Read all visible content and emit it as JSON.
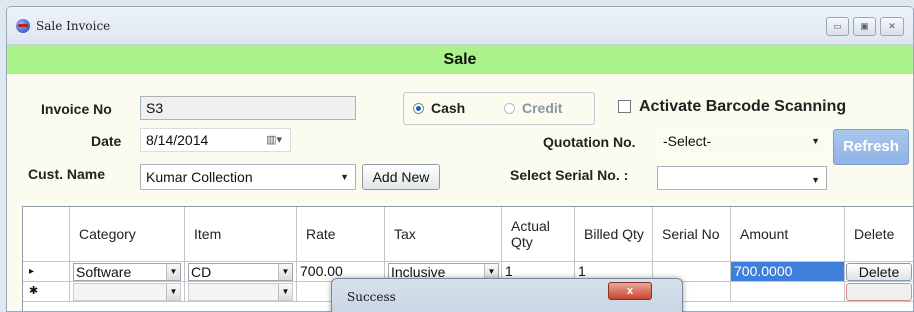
{
  "window": {
    "title": "Sale Invoice",
    "controls": {
      "minimize": "▭",
      "maximize": "▣",
      "close": "✕"
    }
  },
  "banner": {
    "title": "Sale"
  },
  "form": {
    "invoice_no_label": "Invoice No",
    "invoice_no": "S3",
    "date_label": "Date",
    "date": "8/14/2014",
    "cust_name_label": "Cust. Name",
    "cust_name": "Kumar Collection",
    "add_new_label": "Add New",
    "payment": {
      "cash_label": "Cash",
      "credit_label": "Credit",
      "selected": "Cash"
    },
    "barcode_label": "Activate Barcode Scanning",
    "barcode_checked": false,
    "quotation_label": "Quotation No.",
    "quotation_value": "-Select-",
    "refresh_label": "Refresh",
    "serial_label": "Select Serial No. :",
    "serial_value": ""
  },
  "grid": {
    "headers": {
      "category": "Category",
      "item": "Item",
      "rate": "Rate",
      "tax": "Tax",
      "actual_qty": "Actual Qty",
      "billed_qty": "Billed Qty",
      "serial_no": "Serial No",
      "amount": "Amount",
      "delete": "Delete"
    },
    "rows": [
      {
        "indicator": "▸",
        "category": "Software",
        "item": "CD",
        "rate": "700.00",
        "tax": "Inclusive",
        "actual_qty": "1",
        "billed_qty": "1",
        "serial_no": "",
        "amount": "700.0000",
        "delete_label": "Delete"
      },
      {
        "indicator": "✱",
        "category": "",
        "item": "",
        "rate": "",
        "tax": "",
        "actual_qty": "",
        "billed_qty": "",
        "serial_no": "",
        "amount": "",
        "delete_label": ""
      }
    ]
  },
  "dialog": {
    "title": "Success",
    "close": "x"
  },
  "colors": {
    "banner": "#aaf28a",
    "selected_cell": "#3e80d9",
    "background": "#fbfbf0"
  },
  "icons": {
    "app": "app-globe-icon",
    "date_picker": "calendar-icon",
    "dropdown": "chevron-down-icon"
  }
}
